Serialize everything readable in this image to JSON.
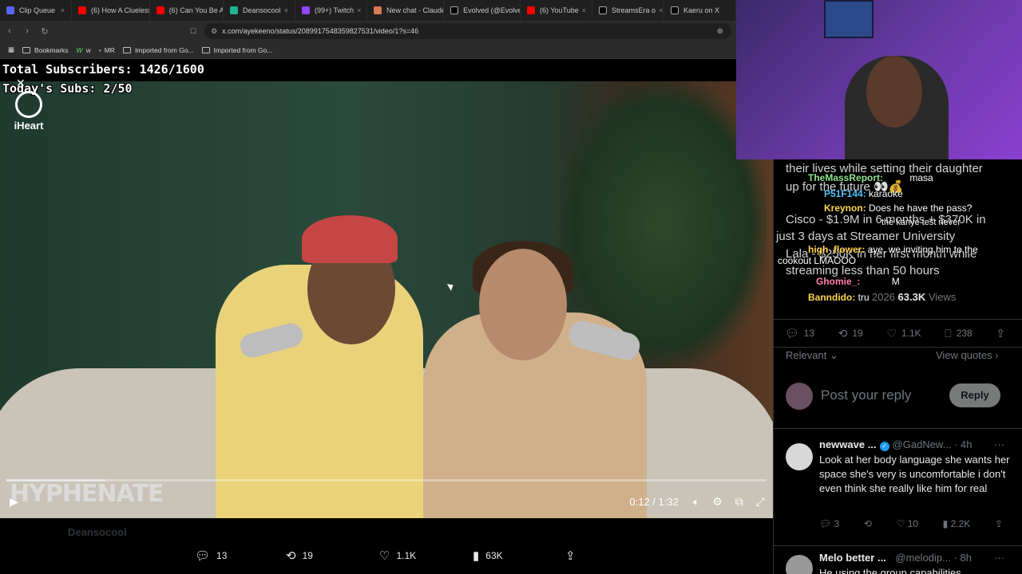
{
  "tabs": [
    "Clip Queue",
    "(6) How A Clueless",
    "(6) Can You Be A",
    "Deansocool",
    "(99+) Twitch",
    "New chat - Claude",
    "Evolved (@Evolve",
    "(6) YouTube",
    "StreamsEra o",
    "Kaeru on X"
  ],
  "browser": {
    "url": "x.com/ayekeeno/status/2089917548359827531/video/1?s=46"
  },
  "bookmarks": [
    "Bookmarks",
    "w",
    "MR",
    "Imported from Go...",
    "Imported from Go..."
  ],
  "overlay": {
    "total_subs": "Total Subscribers: 1426/1600",
    "todays_subs": "Today's Subs: 2/50"
  },
  "video": {
    "logo_text": "iHeart",
    "watermark": "HYPHENATE",
    "time": "0:12 / 1:32",
    "progress": 0.13,
    "ghost_author": "Deansocool"
  },
  "actions": {
    "replies": "13",
    "reposts": "19",
    "likes": "1.1K",
    "views": "63K"
  },
  "chat": [
    {
      "user": "TheMassReport:",
      "text": "masa"
    },
    {
      "user": "P51F144:",
      "text": "karaoke"
    },
    {
      "user": "Kreynon:",
      "text": "Does he have the pass?"
    },
    {
      "text": "the kanye test never"
    },
    {
      "user": "high_flower:",
      "text": "aye, we inviting him to the"
    },
    {
      "text": "cookout LMAOOO"
    },
    {
      "user": "Ghomie_:",
      "text": "M"
    },
    {
      "user": "Banndido:",
      "text": "tru"
    }
  ],
  "tweet": {
    "lines": [
      "their lives while setting their daughter",
      "up for the future 👀💰",
      "Cisco - $1.9M in 6 months + $370K in",
      "just 3 days at Streamer University",
      "Lala - $250K in her first month while",
      "streaming less than 50 hours"
    ],
    "date": "2026",
    "views": "63.3K",
    "views_label": "Views",
    "replies": "13",
    "reposts": "19",
    "likes": "1.1K",
    "bookmarks": "238"
  },
  "replies": {
    "sort": "Relevant",
    "view_quotes": "View quotes"
  },
  "composer": {
    "placeholder": "Post your reply",
    "button": "Reply"
  },
  "reply_list": [
    {
      "name": "newwave ...",
      "handle": "@GadNew... · 4h",
      "text": "Look at her body language she wants her space she's very is uncomfortable i don't even think she really like him for real",
      "replies": "3",
      "likes": "10",
      "views": "2.2K"
    },
    {
      "name": "Melo better ...",
      "handle": "@melodip... · 8h",
      "text": "He using the group capabilities"
    }
  ],
  "colors": {
    "accent": "#1d9bf0",
    "background": "#000000",
    "muted": "#71767b"
  }
}
